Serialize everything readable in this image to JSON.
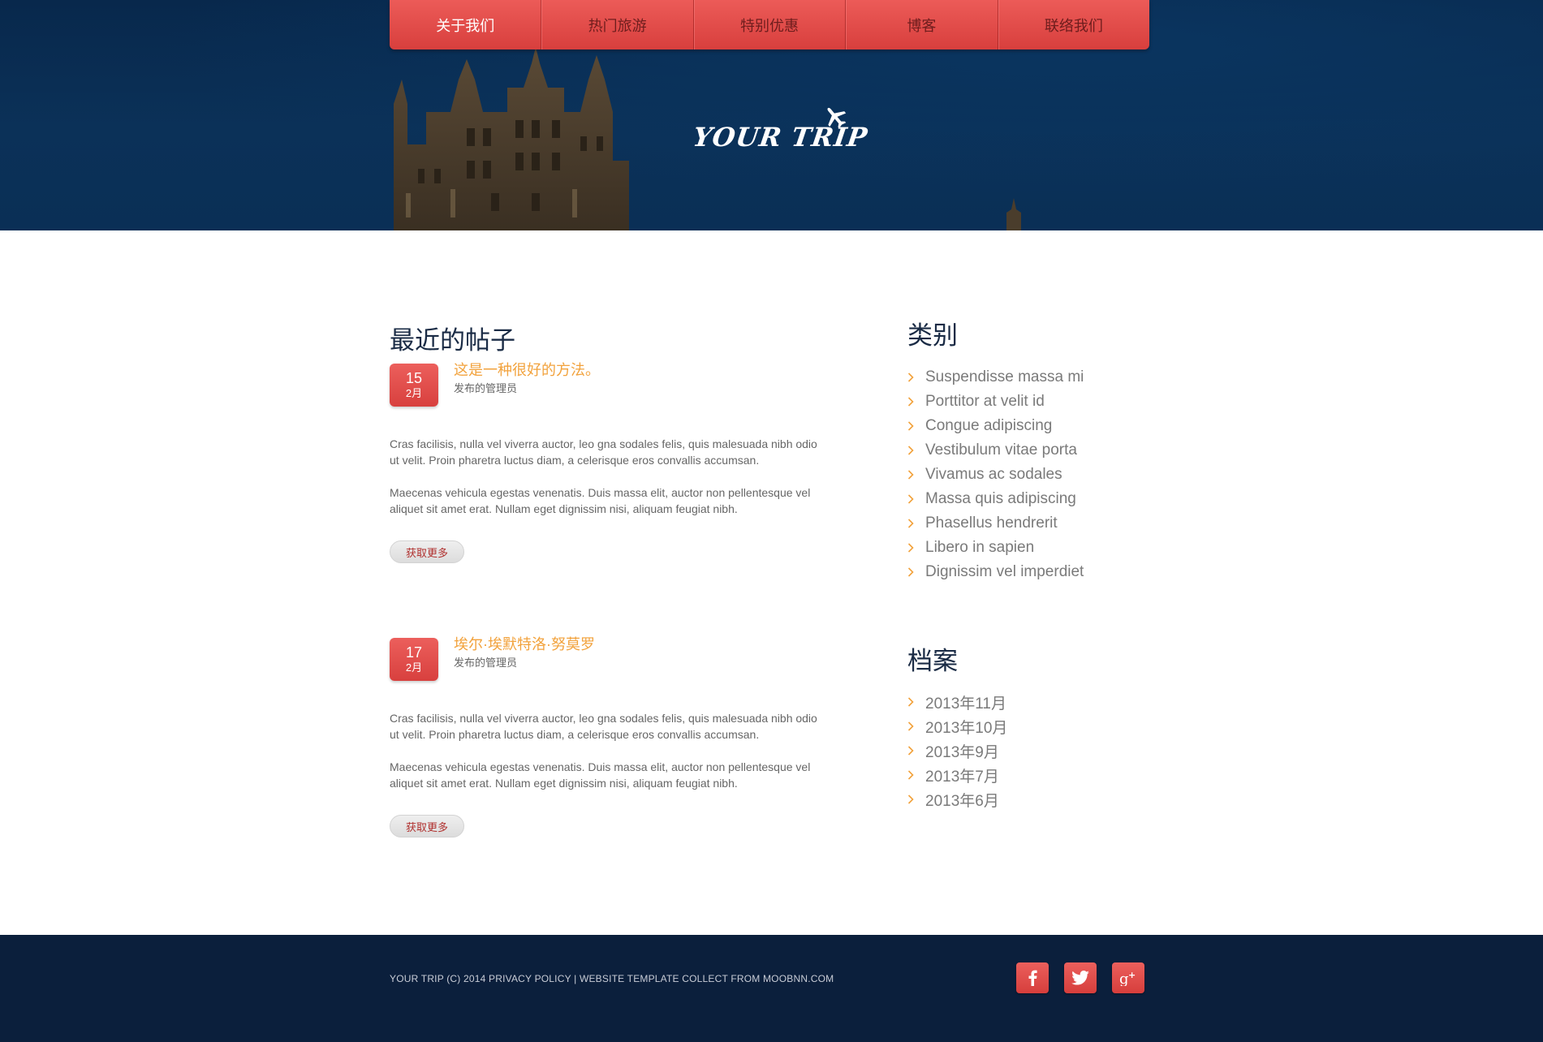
{
  "nav": {
    "items": [
      {
        "label": "关于我们"
      },
      {
        "label": "热门旅游"
      },
      {
        "label": "特别优惠"
      },
      {
        "label": "博客"
      },
      {
        "label": "联络我们"
      }
    ]
  },
  "logo": {
    "text": "YOUR TRIP",
    "icon": "airplane-icon"
  },
  "posts_section": {
    "title": "最近的帖子"
  },
  "posts": [
    {
      "day": "15",
      "month": "2月",
      "title": "这是一种很好的方法。",
      "meta": "发布的管理员",
      "para1": "Cras facilisis, nulla vel viverra auctor, leo gna sodales felis, quis malesuada nibh odio ut velit. Proin pharetra luctus diam, a celerisque eros convallis accumsan.",
      "para2": "Maecenas vehicula egestas venenatis. Duis massa elit, auctor non pellentesque vel aliquet sit amet erat. Nullam eget dignissim nisi, aliquam feugiat nibh.",
      "button": "获取更多"
    },
    {
      "day": "17",
      "month": "2月",
      "title": "埃尔·埃默特洛·努莫罗",
      "meta": "发布的管理员",
      "para1": "Cras facilisis, nulla vel viverra auctor, leo gna sodales felis, quis malesuada nibh odio ut velit. Proin pharetra luctus diam, a celerisque eros convallis accumsan.",
      "para2": "Maecenas vehicula egestas venenatis. Duis massa elit, auctor non pellentesque vel aliquet sit amet erat. Nullam eget dignissim nisi, aliquam feugiat nibh.",
      "button": "获取更多"
    }
  ],
  "categories": {
    "title": "类别",
    "items": [
      "Suspendisse massa mi",
      "Porttitor at velit id",
      "Congue adipiscing",
      "Vestibulum vitae porta",
      "Vivamus ac sodales",
      "Massa quis adipiscing",
      "Phasellus hendrerit",
      "Libero in sapien",
      "Dignissim vel imperdiet"
    ]
  },
  "archive": {
    "title": "档案",
    "items": [
      "2013年11月",
      "2013年10月",
      "2013年9月",
      "2013年7月",
      "2013年6月"
    ]
  },
  "footer": {
    "text": "YOUR TRIP (C) 2014 PRIVACY POLICY | WEBSITE TEMPLATE COLLECT FROM MOOBNN.COM",
    "social": [
      "facebook-icon",
      "twitter-icon",
      "google-plus-icon"
    ]
  },
  "colors": {
    "accent_red": "#e04a48",
    "title_orange": "#f2a23c",
    "heading_navy": "#1a2b45",
    "footer_bg": "#0b1f3c",
    "hero_bg": "#0a2f56"
  }
}
